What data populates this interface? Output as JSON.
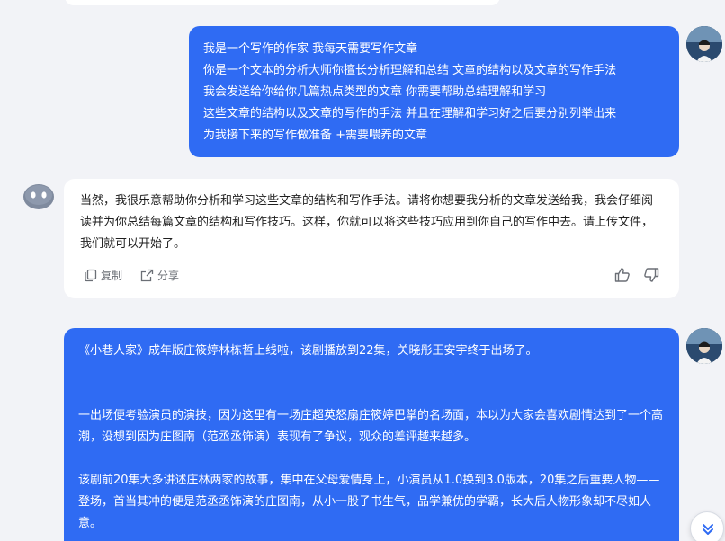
{
  "messages": {
    "user1": {
      "lines": [
        "我是一个写作的作家  我每天需要写作文章",
        "你是一个文本的分析大师你擅长分析理解和总结 文章的结构以及文章的写作手法",
        "我会发送给你给你几篇热点类型的文章  你需要帮助总结理解和学习",
        "这些文章的结构以及文章的写作的手法  并且在理解和学习好之后要分别列举出来",
        "为我接下来的写作做准备  +需要喂养的文章"
      ]
    },
    "bot1": {
      "text": "当然，我很乐意帮助你分析和学习这些文章的结构和写作手法。请将你想要我分析的文章发送给我，我会仔细阅读并为你总结每篇文章的结构和写作技巧。这样，你就可以将这些技巧应用到你自己的写作中去。请上传文件，我们就可以开始了。",
      "copy_label": "复制",
      "share_label": "分享"
    },
    "user2": {
      "paragraphs": [
        "《小巷人家》成年版庄筱婷林栋哲上线啦，该剧播放到22集，关晓彤王安宇终于出场了。",
        "一出场便考验演员的演技，因为这里有一场庄超英怒扇庄筱婷巴掌的名场面，本以为大家会喜欢剧情达到了一个高潮，没想到因为庄图南（范丞丞饰演）表现有了争议，观众的差评越来越多。",
        "该剧前20集大多讲述庄林两家的故事，集中在父母爱情身上，小演员从1.0换到3.0版本，20集之后重要人物——登场，首当其冲的便是范丞丞饰演的庄图南，从小一股子书生气，品学兼优的学霸，长大后人物形象却不尽如人意。"
      ]
    }
  },
  "icons": {
    "copy": "copy-icon",
    "share": "share-icon",
    "like": "thumbs-up-icon",
    "dislike": "thumbs-down-icon",
    "scroll": "double-chevron-down-icon",
    "bot_avatar": "bot-avatar",
    "user_avatar": "user-avatar"
  },
  "colors": {
    "accent": "#2f6bf3",
    "background": "#f2f3f7",
    "bot_bubble": "#ffffff"
  }
}
